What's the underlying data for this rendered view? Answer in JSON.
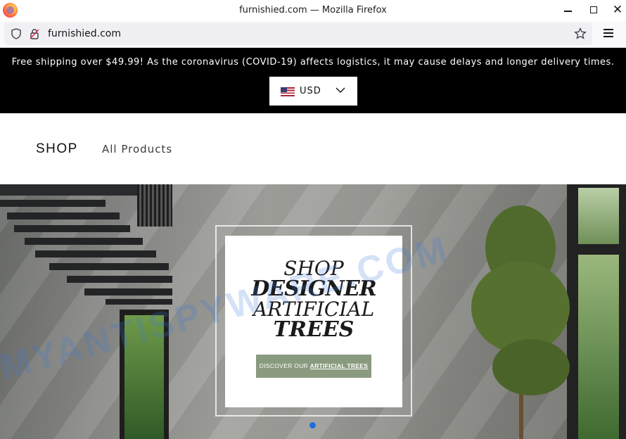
{
  "window": {
    "title": "furnishied.com — Mozilla Firefox"
  },
  "navbar": {
    "url": "furnishied.com"
  },
  "announcement": {
    "text": "Free shipping over $49.99! As the coronavirus (COVID-19) affects logistics, it may cause delays and longer delivery times.",
    "currency": "USD"
  },
  "header": {
    "logo": "SHOP",
    "nav_item": "All Products"
  },
  "hero": {
    "line1": "SHOP",
    "line2": "DESIGNER",
    "line3": "ARTIFICIAL",
    "line4": "TREES",
    "button_prefix": "DISCOVER OUR",
    "button_link": "ARTIFICIAL TREES"
  },
  "watermark": "MYANTISPYWARE.COM",
  "colors": {
    "announcement_bg": "#000000",
    "button_bg": "#8a9a7f",
    "carousel_dot": "#1d6fd9"
  }
}
